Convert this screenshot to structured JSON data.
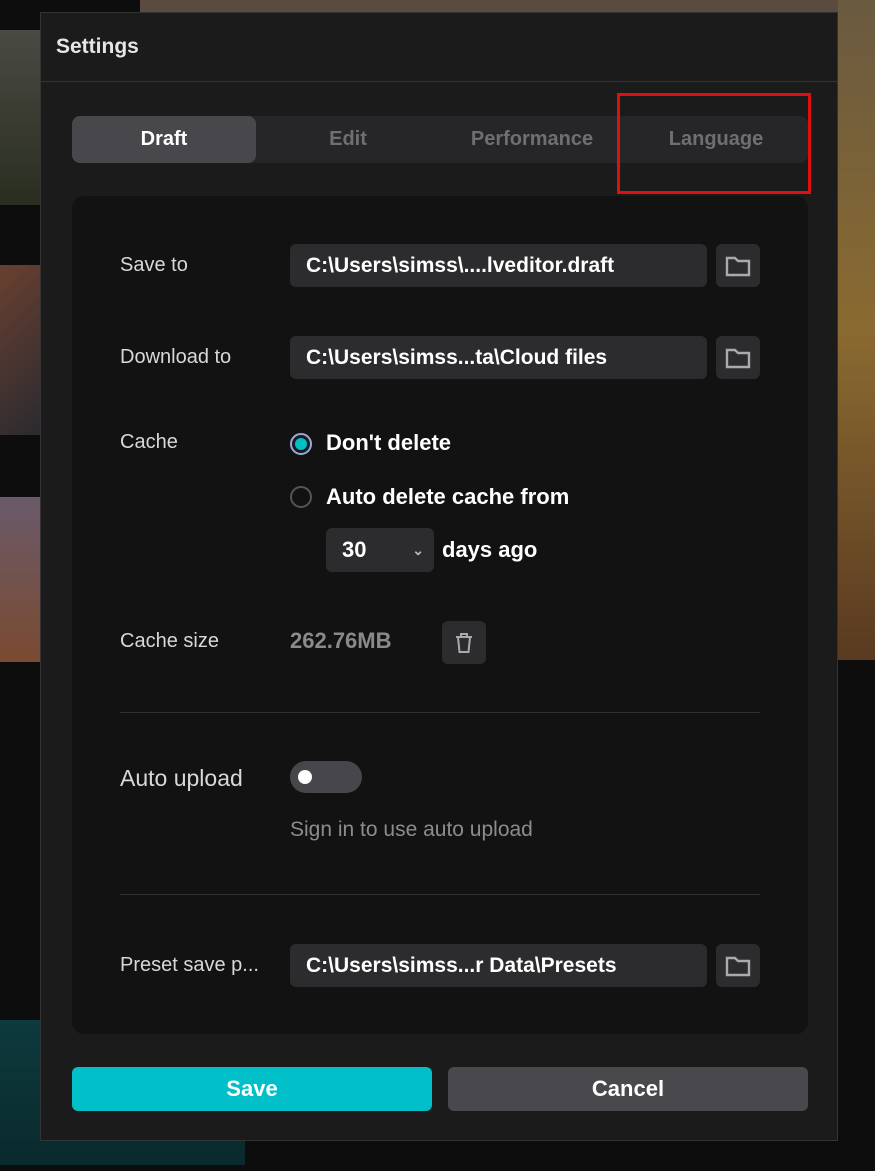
{
  "dialog": {
    "title": "Settings"
  },
  "tabs": [
    {
      "label": "Draft",
      "active": true
    },
    {
      "label": "Edit"
    },
    {
      "label": "Performance"
    },
    {
      "label": "Language"
    }
  ],
  "draft": {
    "save_to": {
      "label": "Save to",
      "value": "C:\\Users\\simss\\....lveditor.draft"
    },
    "download_to": {
      "label": "Download to",
      "value": "C:\\Users\\simss...ta\\Cloud files"
    },
    "cache": {
      "label": "Cache",
      "option_keep": "Don't delete",
      "option_auto": "Auto delete cache from",
      "selected": "Don't delete",
      "days": "30",
      "days_suffix": "days ago"
    },
    "cache_size": {
      "label": "Cache size",
      "value": "262.76MB"
    },
    "auto_upload": {
      "label": "Auto upload",
      "enabled": false,
      "hint": "Sign in to use auto upload"
    },
    "preset": {
      "label": "Preset save p...",
      "value": "C:\\Users\\simss...r Data\\Presets"
    }
  },
  "buttons": {
    "save": "Save",
    "cancel": "Cancel"
  },
  "colors": {
    "accent": "#00bfc8",
    "highlight": "#e01010"
  }
}
